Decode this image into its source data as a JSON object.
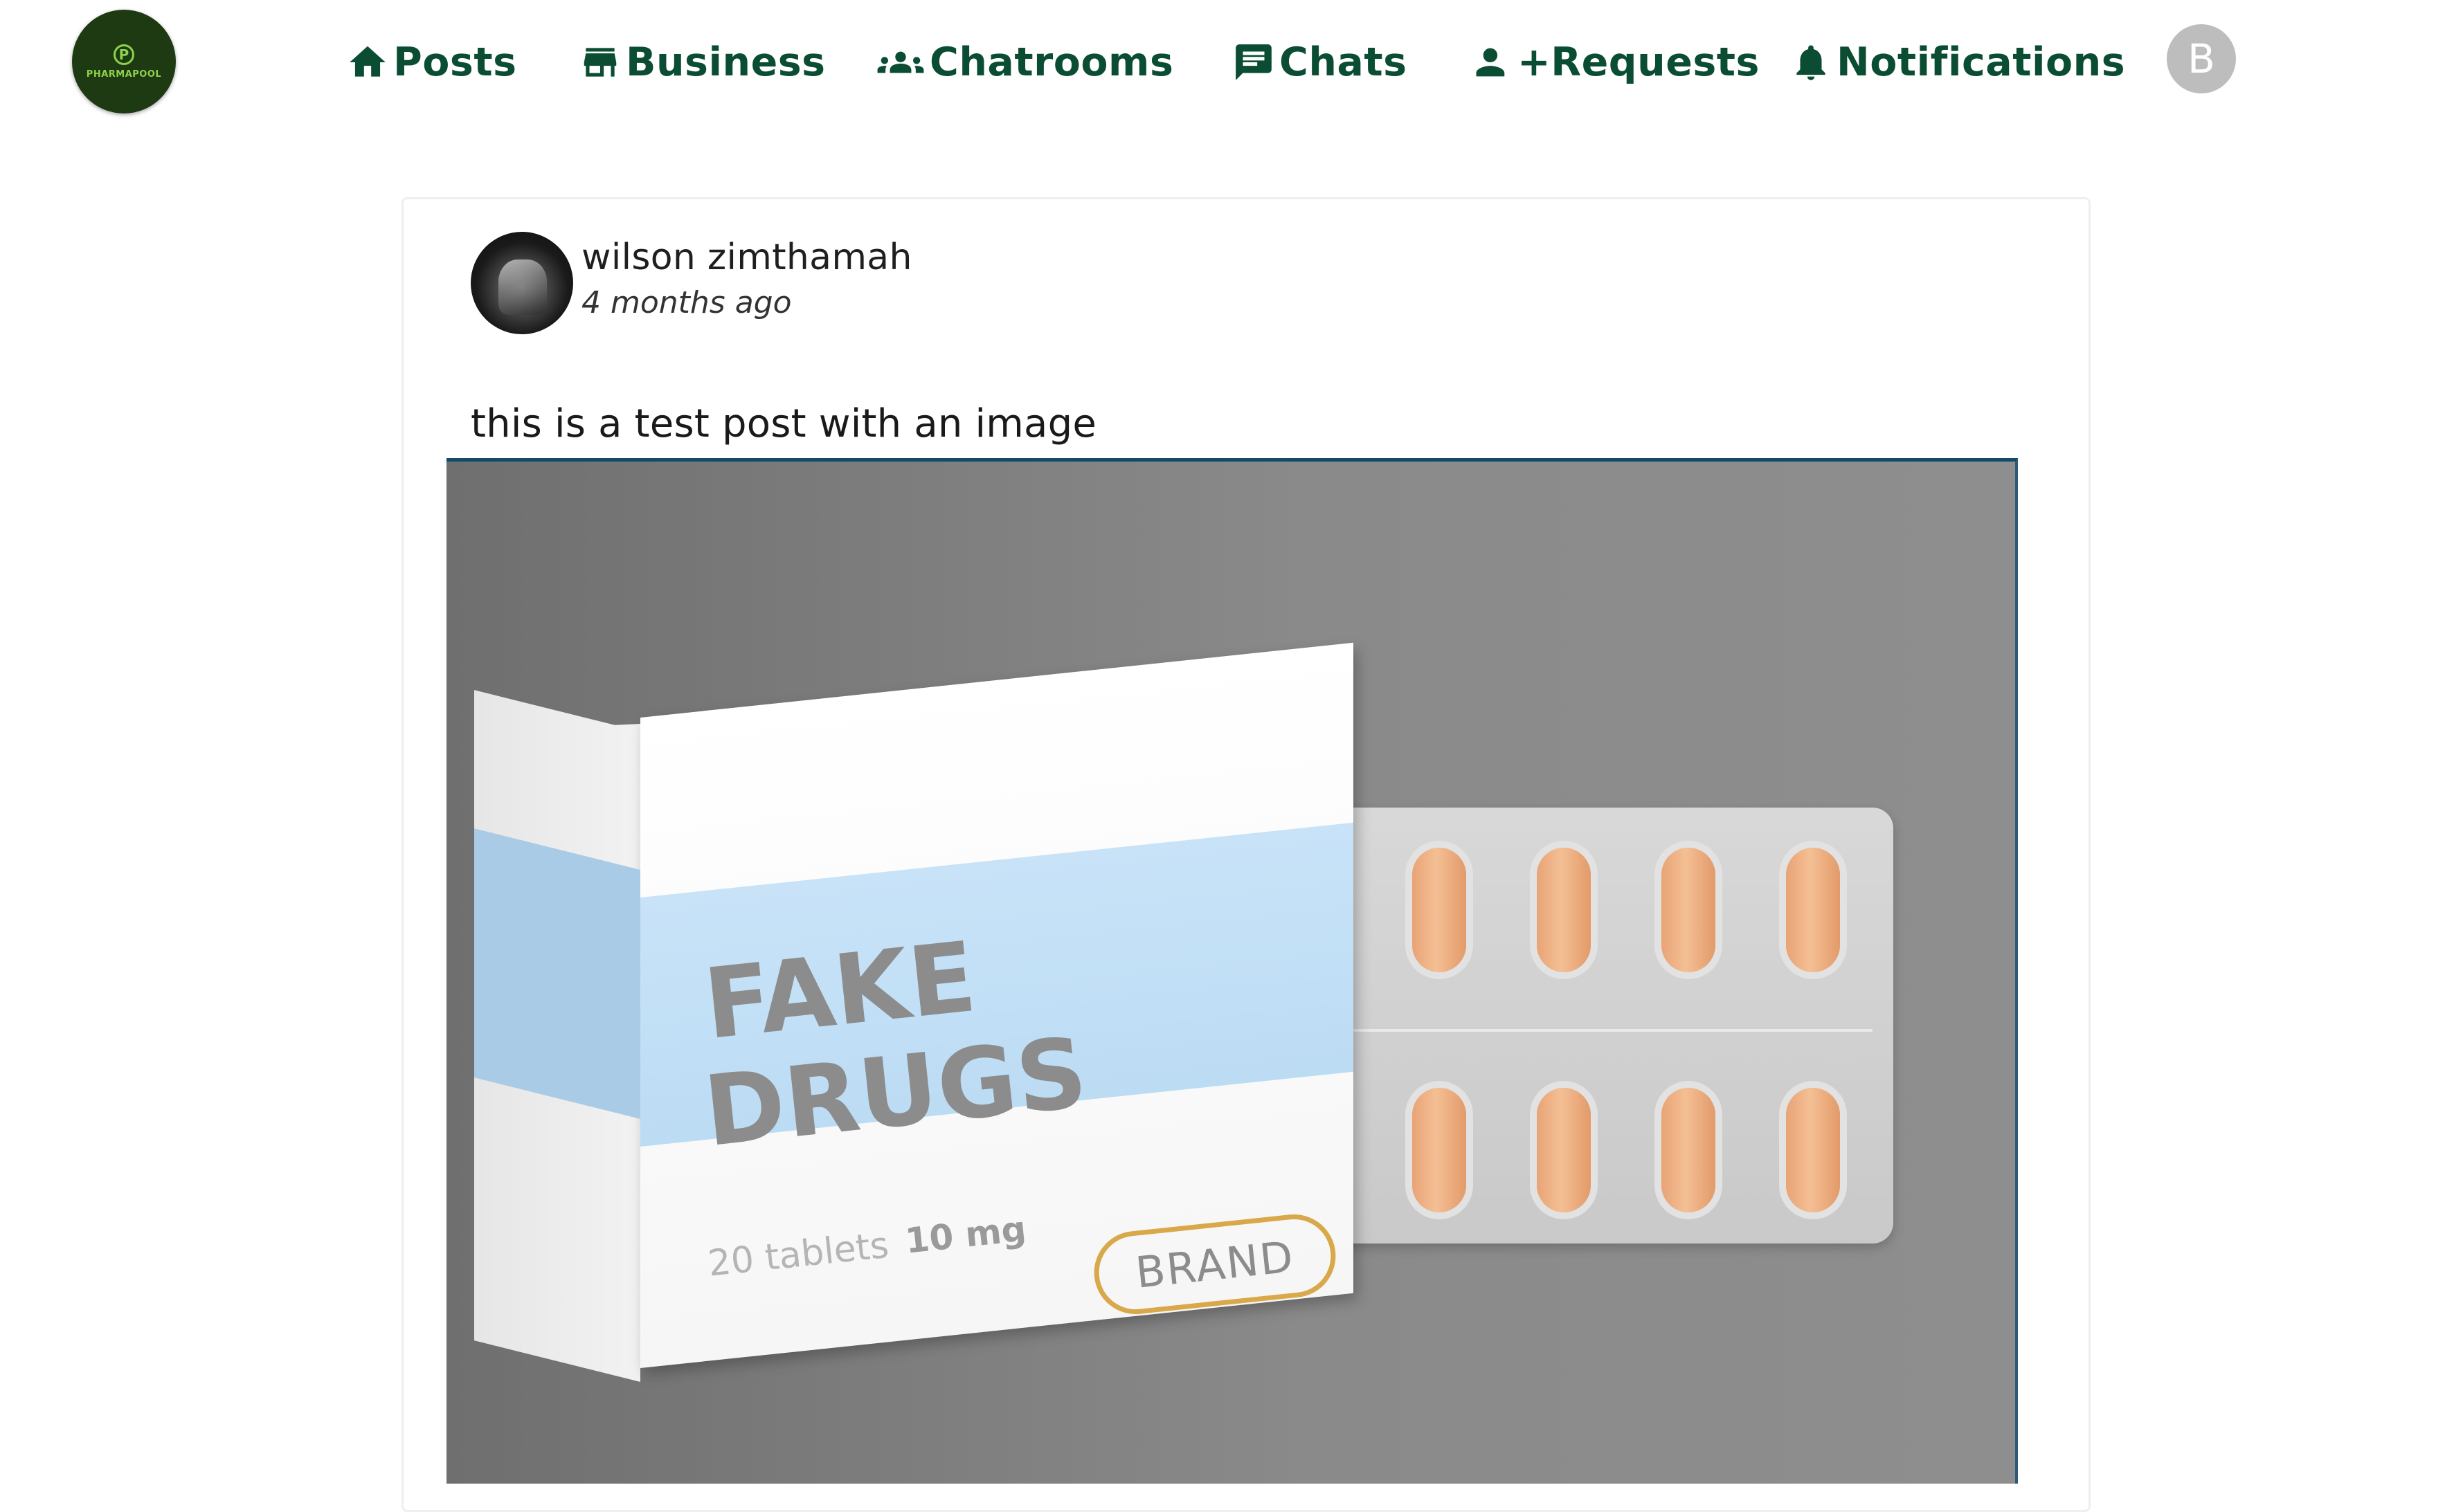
{
  "app": {
    "logo_text": "PHARMAPOOL",
    "logo_mark": "P"
  },
  "nav": {
    "items": [
      {
        "label": "Posts",
        "icon": "home-icon"
      },
      {
        "label": "Business",
        "icon": "store-icon"
      },
      {
        "label": "Chatrooms",
        "icon": "group-icon"
      },
      {
        "label": "Chats",
        "icon": "chat-icon"
      },
      {
        "label": "+Requests",
        "icon": "person-add-icon"
      },
      {
        "label": "Notifications",
        "icon": "bell-icon"
      }
    ],
    "user_initial": "B"
  },
  "post": {
    "author": "wilson zimthamah",
    "time": "4 months ago",
    "text": "this is a test post with an image",
    "image": {
      "line1": "FAKE",
      "line2": "DRUGS",
      "tablets": "20 tablets",
      "dose": "10 mg",
      "brand": "BRAND"
    }
  },
  "colors": {
    "nav_text": "#0a4d32",
    "logo_bg": "#1e3a12",
    "logo_accent": "#8ed14a",
    "avatar_bg": "#bdbdbd"
  }
}
